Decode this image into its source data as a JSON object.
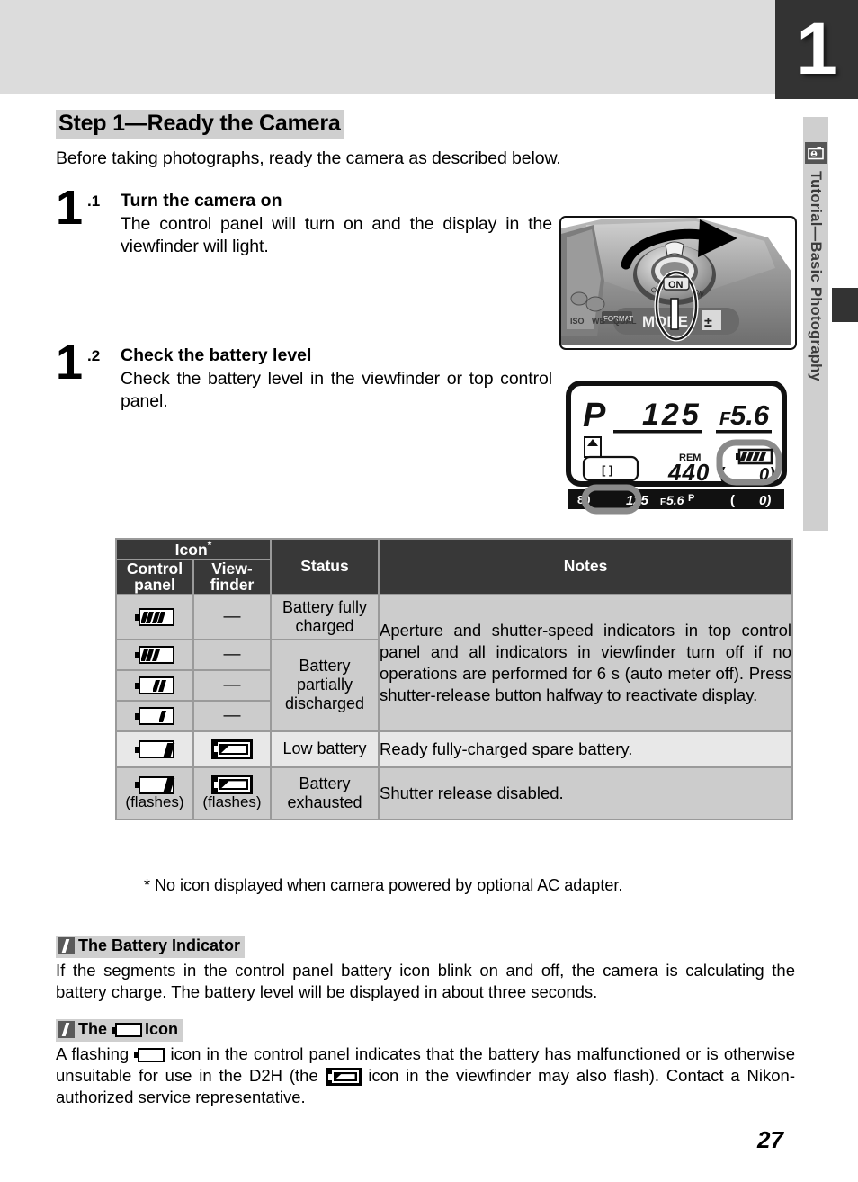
{
  "chapter": {
    "tab_number": "1"
  },
  "sidebar": {
    "icon": "camera-person-icon",
    "label": "Tutorial—Basic Photography"
  },
  "page": {
    "title": "Step 1—Ready the Camera",
    "intro": "Before taking photographs, ready the camera as described below.",
    "page_number": "27"
  },
  "steps": [
    {
      "num": "1",
      "sub": ".1",
      "heading": "Turn the camera on",
      "text": "The control panel will turn on and the display in the viewfinder will light."
    },
    {
      "num": "1",
      "sub": ".2",
      "heading": "Check the battery level",
      "text": "Check the battery level in the viewfinder or top control panel."
    }
  ],
  "figures": {
    "camera": {
      "name": "camera-power-switch-illustration",
      "labels": {
        "mode": "MODE",
        "on": "ON",
        "format": "FORMAT",
        "exposure_comp": "+/-"
      }
    },
    "lcd": {
      "name": "control-panel-lcd-illustration",
      "mode": "P",
      "shutter_speed": "125",
      "aperture": "F5.6",
      "rem_label": "REM",
      "frames_remaining": "440",
      "focus_brackets": "[ ]",
      "viewfinder_strip": {
        "shutter_speed": "125",
        "aperture": "F5.6",
        "mode": "P"
      }
    }
  },
  "table": {
    "headers": {
      "icon_group": "Icon",
      "icon_group_footnote": "*",
      "control_panel": "Control panel",
      "viewfinder": "View- finder",
      "status": "Status",
      "notes": "Notes"
    },
    "rows": [
      {
        "control_panel_icon": "battery-full-icon",
        "viewfinder_icon": "dash",
        "viewfinder_text": "—",
        "status": "Battery fully charged"
      },
      {
        "control_panel_icon": "battery-three-quarter-icon",
        "viewfinder_icon": "dash",
        "viewfinder_text": "—",
        "status": ""
      },
      {
        "control_panel_icon": "battery-half-icon",
        "viewfinder_icon": "dash",
        "viewfinder_text": "—",
        "status": "Battery partially discharged"
      },
      {
        "control_panel_icon": "battery-quarter-icon",
        "viewfinder_icon": "dash",
        "viewfinder_text": "—",
        "status": ""
      },
      {
        "control_panel_icon": "battery-low-icon",
        "viewfinder_icon": "battery-low-viewfinder-icon",
        "viewfinder_text": "",
        "status": "Low battery"
      },
      {
        "control_panel_icon": "battery-exhausted-icon",
        "viewfinder_icon": "battery-exhausted-viewfinder-icon",
        "viewfinder_text": "",
        "status": "Battery exhausted",
        "control_panel_note": "(flashes)",
        "viewfinder_note": "(flashes)"
      }
    ],
    "notes_merged": "Aperture and shutter-speed indicators in top control panel and all indicators in viewfinder turn off if no operations are performed for 6 s (auto meter off).  Press shutter-release button halfway to reactivate display.",
    "notes_low": "Ready fully-charged spare battery.",
    "notes_exhausted": "Shutter release disabled.",
    "footnote": "* No icon displayed when camera powered by optional AC adapter."
  },
  "notes_sections": [
    {
      "title": "The Battery Indicator",
      "body": "If the segments in the control panel battery icon blink on and off, the camera is calculating the battery charge.  The battery level will be displayed in about three seconds."
    },
    {
      "title_before": "The ",
      "title_icon": "battery-malfunction-icon",
      "title_after": "Icon",
      "body_part1": "A flashing ",
      "body_icon1": "battery-malfunction-icon",
      "body_part2": " icon in the control panel indicates that the battery has malfunctioned or is otherwise unsuitable for use in the D2H (the ",
      "body_icon2": "battery-exhausted-viewfinder-icon",
      "body_part3": " icon in the viewfinder may also flash).  Contact a Nikon-authorized service representative."
    }
  ],
  "colors": {
    "header_band": "#dcdcdc",
    "tab_dark": "#333333",
    "table_header": "#383838",
    "table_cell": "#cccccc",
    "table_cell_light": "#e8e8e8",
    "highlight": "#cfcfcf"
  }
}
